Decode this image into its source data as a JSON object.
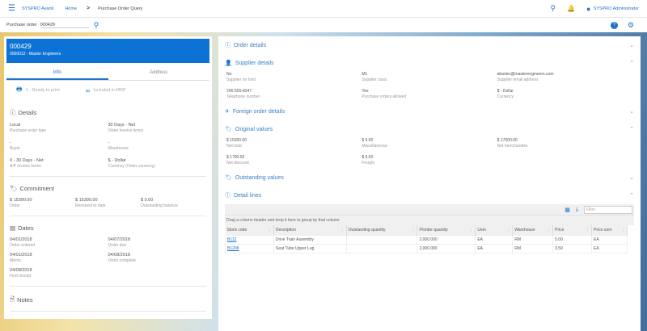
{
  "topbar": {
    "brand": "SYSPRO Avanti",
    "breadcrumb_home": "Home",
    "breadcrumb_sep": ">",
    "breadcrumb_current": "Purchase Order Query",
    "user": "SYSPRO Administrator"
  },
  "search": {
    "label": "Purchase order",
    "value": "000429"
  },
  "order": {
    "number": "000429",
    "supplier": "0000012 - Master Engineers",
    "tabs": [
      "Info",
      "Address"
    ],
    "status_print": "1 - Ready to print",
    "status_mrp": "Included in MRP",
    "details_title": "Details",
    "details": [
      {
        "v": "Local",
        "l": "Purchase order type"
      },
      {
        "v": "30 Days - Net",
        "l": "Order invoice terms"
      },
      {
        "v": "-",
        "l": "Buyer"
      },
      {
        "v": "-",
        "l": "Warehouse"
      },
      {
        "v": "0 - 30 Days - Net",
        "l": "A/P invoice terms"
      },
      {
        "v": "$ - Dollar",
        "l": "Currency (Order currency)"
      }
    ],
    "commitment_title": "Commitment",
    "commitment": [
      {
        "v": "$ 15300.00",
        "l": "Order"
      },
      {
        "v": "$ 15300.00",
        "l": "Received to date"
      },
      {
        "v": "$ 0.00",
        "l": "Outstanding balance"
      }
    ],
    "dates_title": "Dates",
    "dates": [
      {
        "v": "04/01/2018",
        "l": "Order entered"
      },
      {
        "v": "04/07/2018",
        "l": "Order due"
      },
      {
        "v": "04/01/2018",
        "l": "Memo"
      },
      {
        "v": "04/08/2018",
        "l": "Order complete"
      },
      {
        "v": "04/08/2018",
        "l": "First receipt"
      }
    ],
    "notes_title": "Notes"
  },
  "right": {
    "order_details": "Order details",
    "supplier_details": "Supplier details",
    "supplier": [
      {
        "v": "No",
        "l": "Supplier on hold"
      },
      {
        "v": "M1",
        "l": "Supplier class"
      },
      {
        "v": "abaxter@masterengineers.com",
        "l": "Supplier email address"
      },
      {
        "v": "206-555-8347",
        "l": "Telephone number"
      },
      {
        "v": "Yes",
        "l": "Purchase orders allowed"
      },
      {
        "v": "$  - Dollar",
        "l": "Currency"
      }
    ],
    "foreign": "Foreign order details",
    "original_values": "Original values",
    "original": [
      {
        "v": "$ 15300.00",
        "l": "Net total"
      },
      {
        "v": "$ 0.00",
        "l": "Miscellaneous"
      },
      {
        "v": "$ 17000.00",
        "l": "Net merchandise"
      },
      {
        "v": "$ 1700.00",
        "l": "Net discount"
      },
      {
        "v": "$ 0.00",
        "l": "Freight"
      }
    ],
    "outstanding": "Outstanding values",
    "detail_lines": "Detail lines",
    "filter_placeholder": "Filter",
    "group_hint": "Drag a column header and drop it here to group by that column",
    "columns": [
      "Stock code",
      "Description",
      "Outstanding quantity",
      "P/order quantity",
      "Uom",
      "Warehouse",
      "Price",
      "Price uom"
    ],
    "rows": [
      [
        "B112",
        "Drive Train Assembly",
        "",
        "2,000.000",
        "EA",
        "RM",
        "5.00",
        "EA"
      ],
      [
        "B1208",
        "Seat Tube Upper Lug",
        "",
        "2,000.000",
        "EA",
        "RM",
        "3.50",
        "EA"
      ]
    ]
  }
}
